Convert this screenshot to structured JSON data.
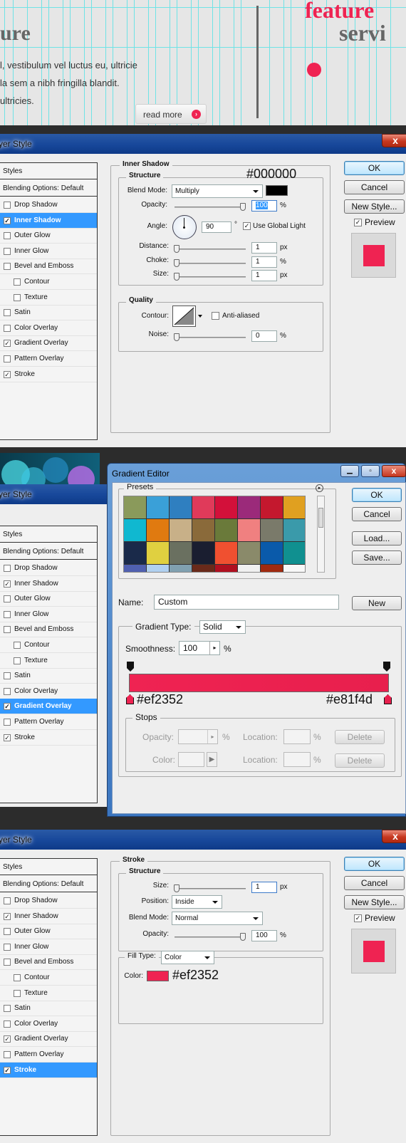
{
  "web_preview": {
    "heading_left": "ure",
    "heading_right_top": "feature",
    "heading_right_bottom": "servi",
    "paragraph_lines": [
      "l, vestibulum vel luctus eu, ultricie",
      "la sem a nibh fringilla blandit.",
      "ultricies."
    ],
    "read_more_label": "read more",
    "read_more_icon": "chevron-right-circle-icon",
    "accent_color": "#ef2352"
  },
  "dialog1": {
    "title": "yer Style",
    "close_label": "x",
    "styles_header": "Styles",
    "blending_options": "Blending Options: Default",
    "items": [
      {
        "label": "Drop Shadow",
        "checked": false,
        "indent": false,
        "selected": false
      },
      {
        "label": "Inner Shadow",
        "checked": true,
        "indent": false,
        "selected": true
      },
      {
        "label": "Outer Glow",
        "checked": false,
        "indent": false,
        "selected": false
      },
      {
        "label": "Inner Glow",
        "checked": false,
        "indent": false,
        "selected": false
      },
      {
        "label": "Bevel and Emboss",
        "checked": false,
        "indent": false,
        "selected": false
      },
      {
        "label": "Contour",
        "checked": false,
        "indent": true,
        "selected": false
      },
      {
        "label": "Texture",
        "checked": false,
        "indent": true,
        "selected": false
      },
      {
        "label": "Satin",
        "checked": false,
        "indent": false,
        "selected": false
      },
      {
        "label": "Color Overlay",
        "checked": false,
        "indent": false,
        "selected": false
      },
      {
        "label": "Gradient Overlay",
        "checked": true,
        "indent": false,
        "selected": false
      },
      {
        "label": "Pattern Overlay",
        "checked": false,
        "indent": false,
        "selected": false
      },
      {
        "label": "Stroke",
        "checked": true,
        "indent": false,
        "selected": false
      }
    ],
    "panel_title": "Inner Shadow",
    "structure_title": "Structure",
    "color_annotation": "#000000",
    "blend_mode_label": "Blend Mode:",
    "blend_mode_value": "Multiply",
    "opacity_label": "Opacity:",
    "opacity_value": "100",
    "opacity_percent": 100,
    "angle_label": "Angle:",
    "angle_value": "90",
    "degree_symbol": "°",
    "use_global_light_label": "Use Global Light",
    "distance_label": "Distance:",
    "distance_value": "1",
    "choke_label": "Choke:",
    "choke_value": "1",
    "size_label": "Size:",
    "size_value": "1",
    "unit_px": "px",
    "unit_percent": "%",
    "quality_title": "Quality",
    "contour_label": "Contour:",
    "anti_aliased_label": "Anti-aliased",
    "noise_label": "Noise:",
    "noise_value": "0",
    "ok_label": "OK",
    "cancel_label": "Cancel",
    "new_style_label": "New Style...",
    "preview_label": "Preview",
    "shadow_color": "#000000",
    "preview_color": "#ef2352"
  },
  "dialog2": {
    "title": "yer Style",
    "styles_header": "Styles",
    "blending_options": "Blending Options: Default",
    "items": [
      {
        "label": "Drop Shadow",
        "checked": false,
        "indent": false,
        "selected": false
      },
      {
        "label": "Inner Shadow",
        "checked": true,
        "indent": false,
        "selected": false
      },
      {
        "label": "Outer Glow",
        "checked": false,
        "indent": false,
        "selected": false
      },
      {
        "label": "Inner Glow",
        "checked": false,
        "indent": false,
        "selected": false
      },
      {
        "label": "Bevel and Emboss",
        "checked": false,
        "indent": false,
        "selected": false
      },
      {
        "label": "Contour",
        "checked": false,
        "indent": true,
        "selected": false
      },
      {
        "label": "Texture",
        "checked": false,
        "indent": true,
        "selected": false
      },
      {
        "label": "Satin",
        "checked": false,
        "indent": false,
        "selected": false
      },
      {
        "label": "Color Overlay",
        "checked": false,
        "indent": false,
        "selected": false
      },
      {
        "label": "Gradient Overlay",
        "checked": true,
        "indent": false,
        "selected": true
      },
      {
        "label": "Pattern Overlay",
        "checked": false,
        "indent": false,
        "selected": false
      },
      {
        "label": "Stroke",
        "checked": true,
        "indent": false,
        "selected": false
      }
    ]
  },
  "gradient_editor": {
    "title": "Gradient Editor",
    "window_icons": [
      "minimize-icon",
      "maximize-icon",
      "close-icon"
    ],
    "presets_title": "Presets",
    "presets_menu_icon": "arrow-right-circle-icon",
    "preset_colors": [
      "#8a9a5b",
      "#3aa0d8",
      "#2f7fc0",
      "#e03a5a",
      "#d3103a",
      "#9b2a7a",
      "#c4182e",
      "#e0a020",
      "#10b8d0",
      "#e07a10",
      "#c8b088",
      "#8a6a3a",
      "#6a7a3a",
      "#f08080",
      "#7a7a6a",
      "#3a9aaa",
      "#1a2a4a",
      "#e0d040",
      "#6a7060",
      "#1a1e30",
      "#f05030",
      "#8a8a6a",
      "#0a5aaa",
      "#109090",
      "#5060b0",
      "#b0d0f0",
      "#80a0b0",
      "#6a2a1a",
      "#b01020",
      "#f0f0f0",
      "#a02a10",
      "#f8f8f8"
    ],
    "ok_label": "OK",
    "cancel_label": "Cancel",
    "load_label": "Load...",
    "save_label": "Save...",
    "name_label": "Name:",
    "name_value": "Custom",
    "new_label": "New",
    "gradient_type_label": "Gradient Type:",
    "gradient_type_value": "Solid",
    "smoothness_label": "Smoothness:",
    "smoothness_value": "100",
    "percent": "%",
    "stop_left_color": "#ef2352",
    "stop_right_color": "#e81f4d",
    "stop_left_label": "#ef2352",
    "stop_right_label": "#e81f4d",
    "stops_title": "Stops",
    "opacity_label": "Opacity:",
    "location_label": "Location:",
    "delete_label": "Delete",
    "color_label": "Color:",
    "background_strip_colors": [
      "#3fd0e0",
      "#1a8ab0",
      "#c070e0"
    ]
  },
  "dialog3": {
    "title": "yer Style",
    "close_label": "x",
    "styles_header": "Styles",
    "blending_options": "Blending Options: Default",
    "items": [
      {
        "label": "Drop Shadow",
        "checked": false,
        "indent": false,
        "selected": false
      },
      {
        "label": "Inner Shadow",
        "checked": true,
        "indent": false,
        "selected": false
      },
      {
        "label": "Outer Glow",
        "checked": false,
        "indent": false,
        "selected": false
      },
      {
        "label": "Inner Glow",
        "checked": false,
        "indent": false,
        "selected": false
      },
      {
        "label": "Bevel and Emboss",
        "checked": false,
        "indent": false,
        "selected": false
      },
      {
        "label": "Contour",
        "checked": false,
        "indent": true,
        "selected": false
      },
      {
        "label": "Texture",
        "checked": false,
        "indent": true,
        "selected": false
      },
      {
        "label": "Satin",
        "checked": false,
        "indent": false,
        "selected": false
      },
      {
        "label": "Color Overlay",
        "checked": false,
        "indent": false,
        "selected": false
      },
      {
        "label": "Gradient Overlay",
        "checked": true,
        "indent": false,
        "selected": false
      },
      {
        "label": "Pattern Overlay",
        "checked": false,
        "indent": false,
        "selected": false
      },
      {
        "label": "Stroke",
        "checked": true,
        "indent": false,
        "selected": true
      }
    ],
    "panel_title": "Stroke",
    "structure_title": "Structure",
    "size_label": "Size:",
    "size_value": "1",
    "unit_px": "px",
    "position_label": "Position:",
    "position_value": "Inside",
    "blend_mode_label": "Blend Mode:",
    "blend_mode_value": "Normal",
    "opacity_label": "Opacity:",
    "opacity_value": "100",
    "opacity_percent": 100,
    "unit_percent": "%",
    "fill_type_label": "Fill Type:",
    "fill_type_value": "Color",
    "color_label": "Color:",
    "stroke_color": "#ef2352",
    "color_annotation": "#ef2352",
    "ok_label": "OK",
    "cancel_label": "Cancel",
    "new_style_label": "New Style...",
    "preview_label": "Preview",
    "preview_color": "#ef2352"
  }
}
